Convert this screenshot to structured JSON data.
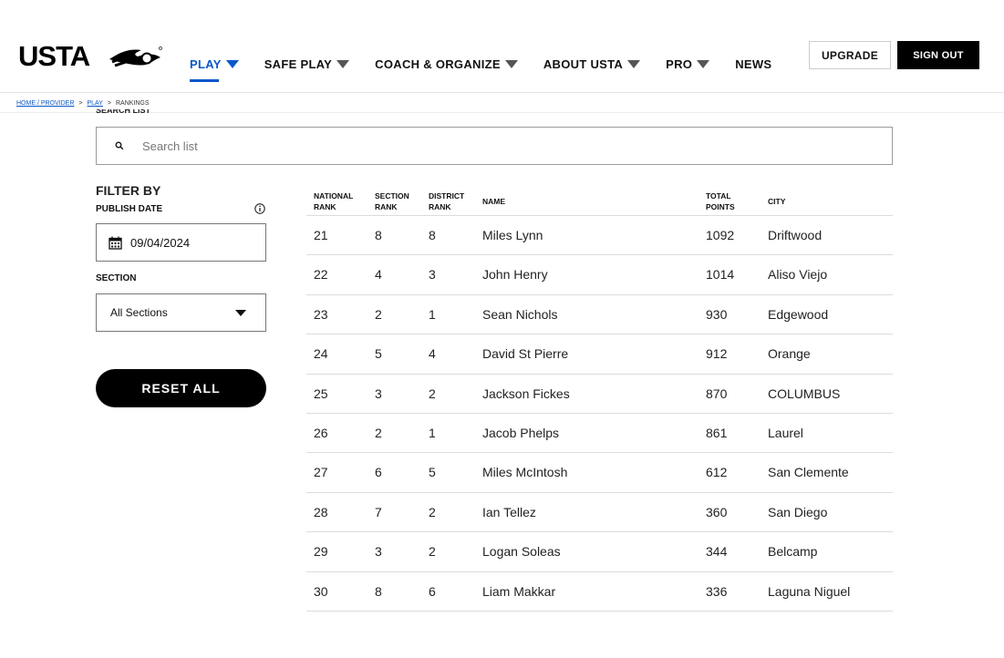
{
  "header": {
    "logo_text": "USTA",
    "nav": [
      {
        "label": "PLAY",
        "active": true,
        "has_caret": true
      },
      {
        "label": "SAFE PLAY",
        "active": false,
        "has_caret": true
      },
      {
        "label": "COACH & ORGANIZE",
        "active": false,
        "has_caret": true
      },
      {
        "label": "ABOUT USTA",
        "active": false,
        "has_caret": true
      },
      {
        "label": "PRO",
        "active": false,
        "has_caret": true
      },
      {
        "label": "NEWS",
        "active": false,
        "has_caret": false
      }
    ],
    "upgrade_label": "UPGRADE",
    "signout_label": "SIGN OUT"
  },
  "breadcrumb": {
    "home": "HOME / PROVIDER",
    "sep1": ">",
    "play": "PLAY",
    "sep2": ">",
    "current": "RANKINGS"
  },
  "search": {
    "label": "SEARCH LIST",
    "placeholder": "Search list"
  },
  "filters": {
    "title": "FILTER BY",
    "publish_date_label": "PUBLISH DATE",
    "publish_date_value": "09/04/2024",
    "section_label": "SECTION",
    "section_value": "All Sections",
    "reset_label": "RESET ALL"
  },
  "table": {
    "headers": {
      "national_1": "NATIONAL",
      "national_2": "RANK",
      "section_1": "SECTION",
      "section_2": "RANK",
      "district_1": "DISTRICT",
      "district_2": "RANK",
      "name": "NAME",
      "points_1": "TOTAL",
      "points_2": "POINTS",
      "city": "CITY"
    },
    "rows": [
      {
        "national": "21",
        "section": "8",
        "district": "8",
        "name": "Miles Lynn",
        "points": "1092",
        "city": "Driftwood"
      },
      {
        "national": "22",
        "section": "4",
        "district": "3",
        "name": "John Henry",
        "points": "1014",
        "city": "Aliso Viejo"
      },
      {
        "national": "23",
        "section": "2",
        "district": "1",
        "name": "Sean Nichols",
        "points": "930",
        "city": "Edgewood"
      },
      {
        "national": "24",
        "section": "5",
        "district": "4",
        "name": "David St Pierre",
        "points": "912",
        "city": "Orange"
      },
      {
        "national": "25",
        "section": "3",
        "district": "2",
        "name": "Jackson Fickes",
        "points": "870",
        "city": "COLUMBUS"
      },
      {
        "national": "26",
        "section": "2",
        "district": "1",
        "name": "Jacob Phelps",
        "points": "861",
        "city": "Laurel"
      },
      {
        "national": "27",
        "section": "6",
        "district": "5",
        "name": "Miles McIntosh",
        "points": "612",
        "city": "San Clemente"
      },
      {
        "national": "28",
        "section": "7",
        "district": "2",
        "name": "Ian Tellez",
        "points": "360",
        "city": "San Diego"
      },
      {
        "national": "29",
        "section": "3",
        "district": "2",
        "name": "Logan Soleas",
        "points": "344",
        "city": "Belcamp"
      },
      {
        "national": "30",
        "section": "8",
        "district": "6",
        "name": "Liam Makkar",
        "points": "336",
        "city": "Laguna Niguel"
      }
    ]
  },
  "colors": {
    "accent": "#0b57c9",
    "button_dark": "#000000"
  }
}
